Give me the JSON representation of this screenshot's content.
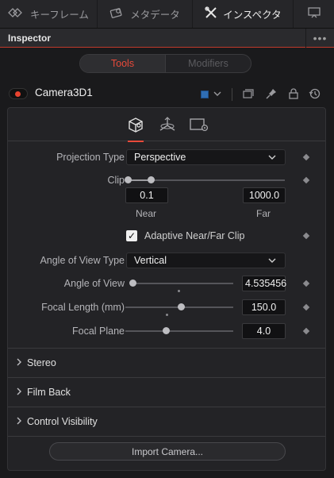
{
  "tabs": [
    {
      "label": "キーフレーム",
      "icon": "keyframe-icon"
    },
    {
      "label": "メタデータ",
      "icon": "metadata-icon"
    },
    {
      "label": "インスペクタ",
      "icon": "inspector-icon"
    },
    {
      "label": "",
      "icon": "monitor-icon"
    }
  ],
  "panel": {
    "title": "Inspector"
  },
  "segment": {
    "tools": "Tools",
    "modifiers": "Modifiers"
  },
  "node": {
    "name": "Camera3D1",
    "color": "#2f6db3"
  },
  "controls": {
    "projection_type": {
      "label": "Projection Type",
      "value": "Perspective"
    },
    "clip": {
      "label": "Clip",
      "near": "0.1",
      "far": "1000.0",
      "near_label": "Near",
      "far_label": "Far"
    },
    "adaptive": {
      "label": "Adaptive Near/Far Clip",
      "checked": true
    },
    "aov_type": {
      "label": "Angle of View Type",
      "value": "Vertical"
    },
    "aov": {
      "label": "Angle of View",
      "value": "4.535456"
    },
    "focal_length": {
      "label": "Focal Length (mm)",
      "value": "150.0"
    },
    "focal_plane": {
      "label": "Focal Plane",
      "value": "4.0"
    }
  },
  "sections": [
    "Stereo",
    "Film Back",
    "Control Visibility"
  ],
  "import_button": "Import Camera..."
}
